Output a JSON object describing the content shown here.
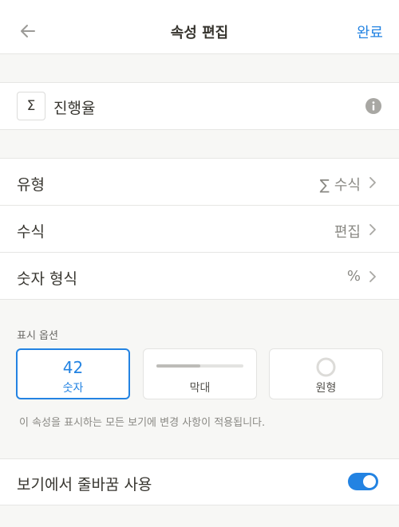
{
  "header": {
    "title": "속성 편집",
    "done_label": "완료"
  },
  "property": {
    "icon": "sigma-icon",
    "icon_glyph": "Σ",
    "name": "진행율"
  },
  "settings": {
    "rows": [
      {
        "label": "유형",
        "value_icon": "∑",
        "value": "수식"
      },
      {
        "label": "수식",
        "value": "편집"
      },
      {
        "label": "숫자 형식",
        "value": "%"
      }
    ]
  },
  "display": {
    "label": "표시 옵션",
    "options": [
      {
        "sample": "42",
        "label": "숫자",
        "selected": true
      },
      {
        "label": "막대",
        "bar_fill_fraction": 0.5,
        "selected": false
      },
      {
        "label": "원형",
        "selected": false
      }
    ],
    "hint": "이 속성을 표시하는 모든 보기에 변경 사항이 적용됩니다."
  },
  "wrap": {
    "label": "보기에서 줄바꿈 사용",
    "enabled": true
  },
  "colors": {
    "accent": "#2383e2",
    "background": "#f7f7f5",
    "text": "#37352f",
    "muted": "#8a8984"
  }
}
